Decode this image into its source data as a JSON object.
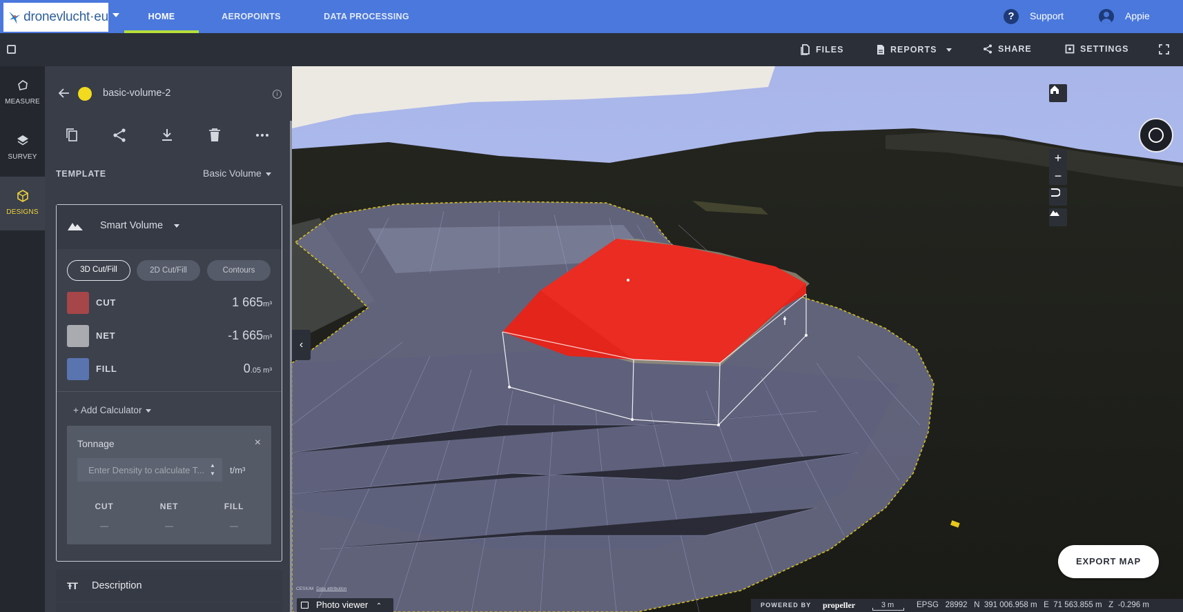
{
  "brand": {
    "logo_text": "dronevlucht·eu"
  },
  "nav": {
    "tabs": [
      {
        "label": "HOME",
        "active": true
      },
      {
        "label": "AEROPOINTS",
        "active": false
      },
      {
        "label": "DATA PROCESSING",
        "active": false
      }
    ],
    "support_label": "Support",
    "user_name": "Appie"
  },
  "toolbar": {
    "files_label": "FILES",
    "reports_label": "REPORTS",
    "share_label": "SHARE",
    "settings_label": "SETTINGS"
  },
  "rail": {
    "items": [
      {
        "label": "MEASURE",
        "icon": "hexagon-icon",
        "active": false
      },
      {
        "label": "SURVEY",
        "icon": "layers-icon",
        "active": false
      },
      {
        "label": "DESIGNS",
        "icon": "cube-icon",
        "active": true
      }
    ]
  },
  "panel": {
    "measurement_name": "basic-volume-2",
    "measurement_color": "#f2da1e",
    "template_label": "TEMPLATE",
    "template_value": "Basic Volume",
    "card_title": "Smart Volume",
    "modes": [
      {
        "label": "3D Cut/Fill",
        "active": true
      },
      {
        "label": "2D Cut/Fill",
        "active": false
      },
      {
        "label": "Contours",
        "active": false
      }
    ],
    "volumes": {
      "cut": {
        "label": "CUT",
        "value": "1 665",
        "unit": "m³",
        "color": "#a64648"
      },
      "net": {
        "label": "NET",
        "value": "-1 665",
        "unit": "m³",
        "color": "#a9abb0"
      },
      "fill": {
        "label": "FILL",
        "value": "0",
        "decimal": ".05",
        "unit": " m³",
        "color": "#5a74b0"
      }
    },
    "add_calculator_label": "+ Add Calculator",
    "tonnage": {
      "title": "Tonnage",
      "close": "×",
      "density_placeholder": "Enter Density to calculate T...",
      "density_unit": "t/m³",
      "columns": [
        {
          "label": "CUT",
          "value": "—"
        },
        {
          "label": "NET",
          "value": "—"
        },
        {
          "label": "FILL",
          "value": "—"
        }
      ]
    },
    "description_label": "Description"
  },
  "map": {
    "export_label": "EXPORT MAP",
    "cesium_text": "CESIUM",
    "data_attribution": "Data attribution",
    "photo_viewer_label": "Photo viewer",
    "powered_by": "POWERED BY",
    "powered_brand": "propeller",
    "scale": "3 m",
    "coords": {
      "epsg_label": "EPSG",
      "epsg": "28992",
      "n_label": "N",
      "n": "391 006.958 m",
      "e_label": "E",
      "e": "71 563.855 m",
      "z_label": "Z",
      "z": "-0.296 m"
    }
  }
}
